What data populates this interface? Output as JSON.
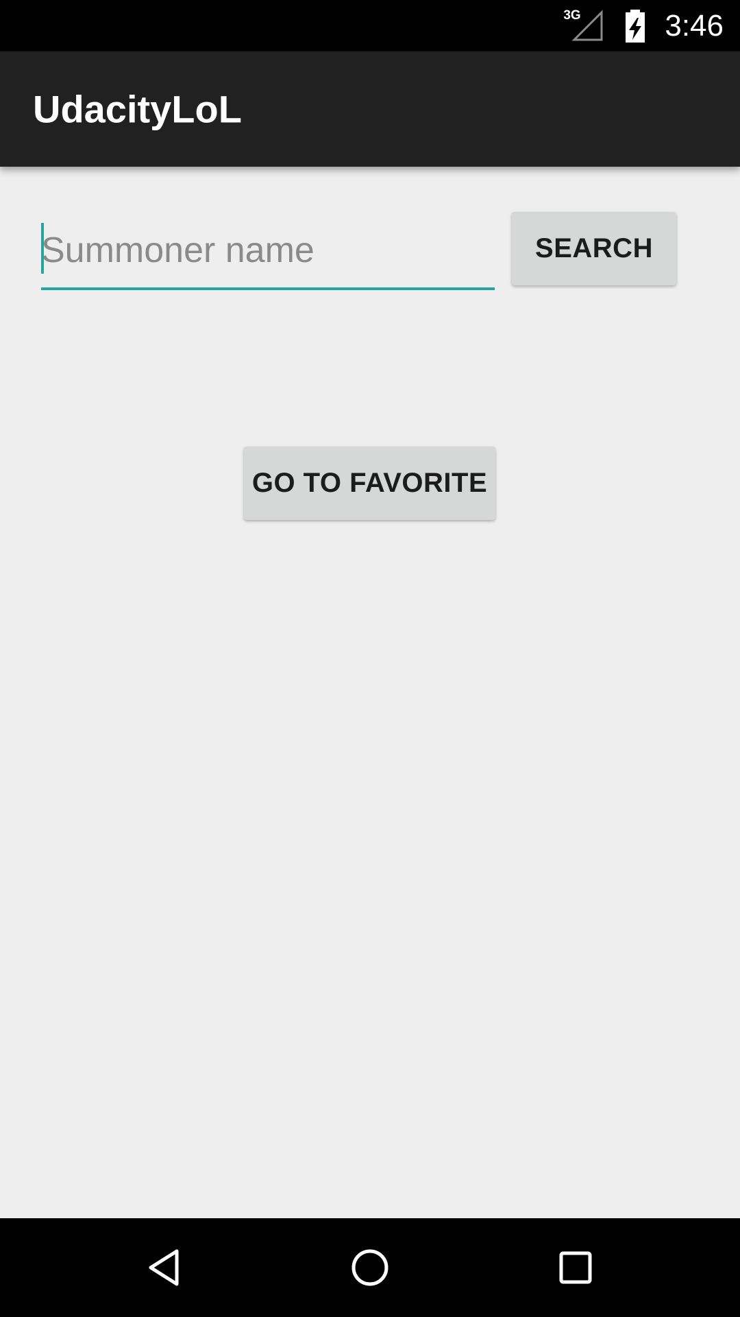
{
  "status_bar": {
    "network_type": "3G",
    "time": "3:46",
    "icons": [
      "signal-icon",
      "battery-charging-icon"
    ]
  },
  "app_bar": {
    "title": "UdacityLoL"
  },
  "search": {
    "value": "",
    "placeholder": "Summoner name",
    "button_label": "SEARCH"
  },
  "favorite": {
    "button_label": "GO TO FAVORITE"
  },
  "nav_bar": {
    "icons": [
      "back-icon",
      "home-icon",
      "recents-icon"
    ]
  },
  "colors": {
    "accent": "#26a69a",
    "app_bar": "#212121",
    "background": "#eeeeee",
    "button": "#d6d7d7"
  }
}
